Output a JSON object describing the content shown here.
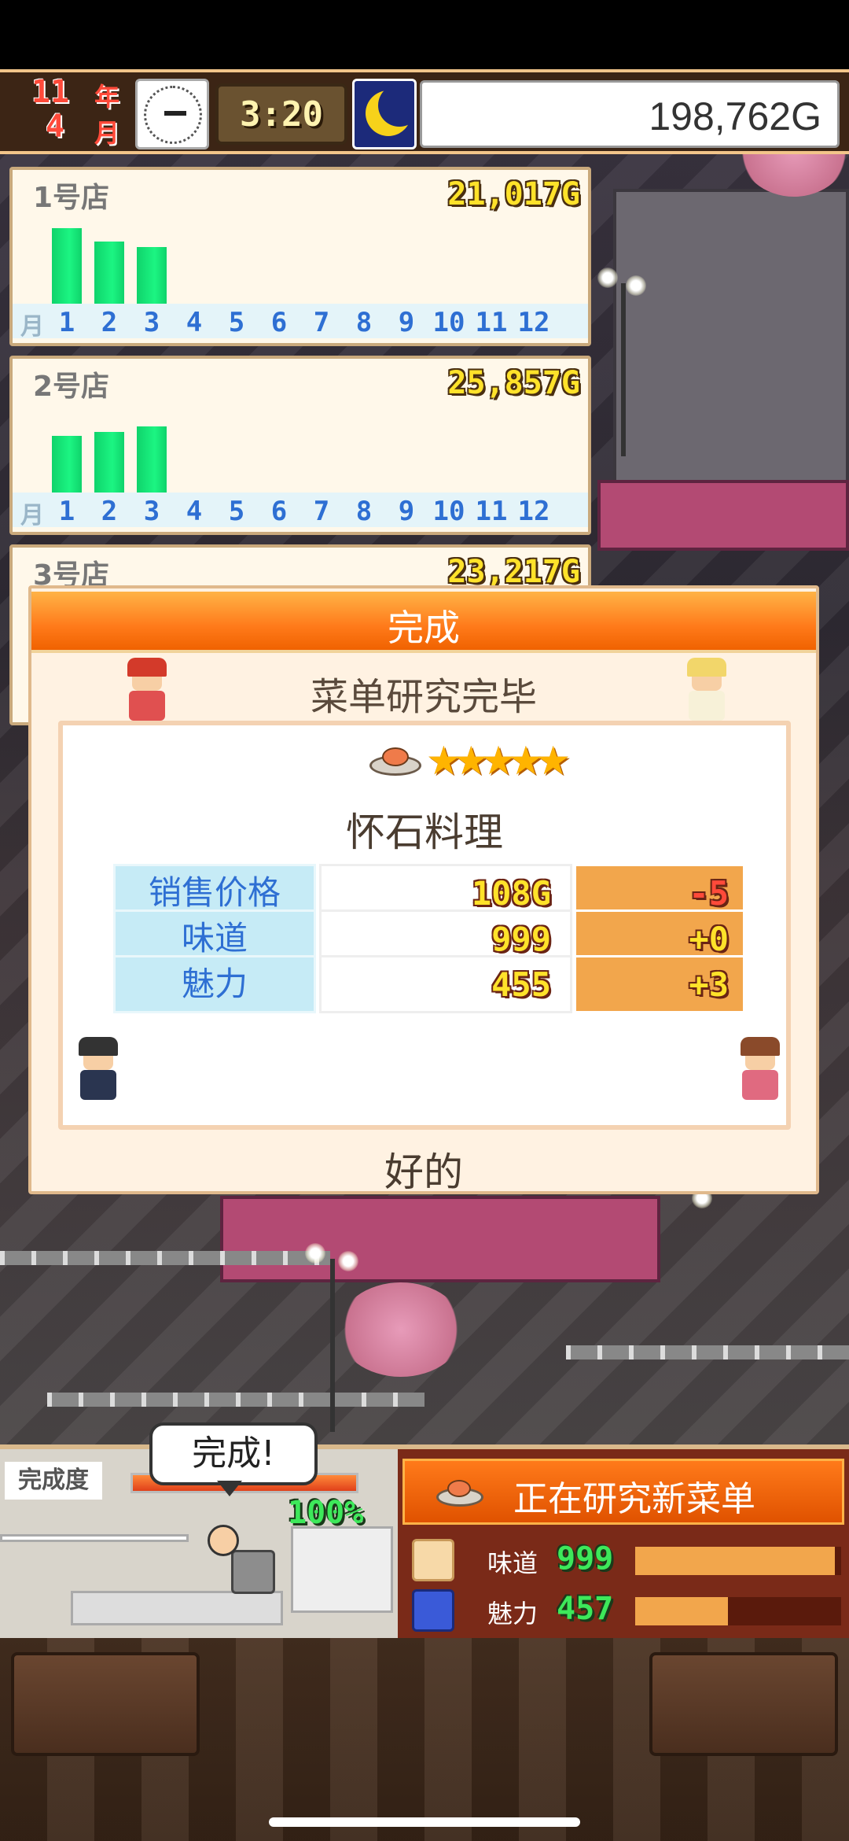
{
  "status_bar": {
    "year_num": "11",
    "year_unit": "年",
    "month_num": "4",
    "month_unit": "月",
    "time": "3:20",
    "money": "198,762G"
  },
  "stores": [
    {
      "name": "1号店",
      "amount": "21,017G",
      "sales_fraction": [
        0.82,
        0.68,
        0.62,
        0,
        0,
        0,
        0,
        0,
        0,
        0,
        0,
        0
      ]
    },
    {
      "name": "2号店",
      "amount": "25,857G",
      "sales_fraction": [
        0.62,
        0.66,
        0.72,
        0,
        0,
        0,
        0,
        0,
        0,
        0,
        0,
        0
      ]
    },
    {
      "name": "3号店",
      "amount": "23,217G"
    }
  ],
  "months": {
    "label": "月",
    "items": [
      "1",
      "2",
      "3",
      "4",
      "5",
      "6",
      "7",
      "8",
      "9",
      "10",
      "11",
      "12"
    ]
  },
  "dialog": {
    "title": "完成",
    "subtitle": "菜单研究完毕",
    "stars": "★★★★★",
    "dish_name": "怀石料理",
    "stats": [
      {
        "label": "销售价格",
        "value": "108G",
        "change": "-5",
        "change_color": "#ff4a3a"
      },
      {
        "label": "味道",
        "value": "999",
        "change": "+0",
        "change_color": "#ffe22a"
      },
      {
        "label": "魅力",
        "value": "455",
        "change": "+3",
        "change_color": "#ffe22a"
      }
    ],
    "ok_label": "好的"
  },
  "research": {
    "progress_label": "完成度",
    "speech": "完成!",
    "progress_pct": "100%",
    "progress_fraction": 1.0,
    "title": "正在研究新菜单",
    "rows": [
      {
        "label": "味道",
        "value": "999",
        "fraction": 0.97
      },
      {
        "label": "魅力",
        "value": "457",
        "fraction": 0.45
      }
    ]
  },
  "colors": {
    "accent_orange": "#ff7a1a",
    "bar_green": "#1cf582",
    "money_yellow": "#ffe22a"
  }
}
